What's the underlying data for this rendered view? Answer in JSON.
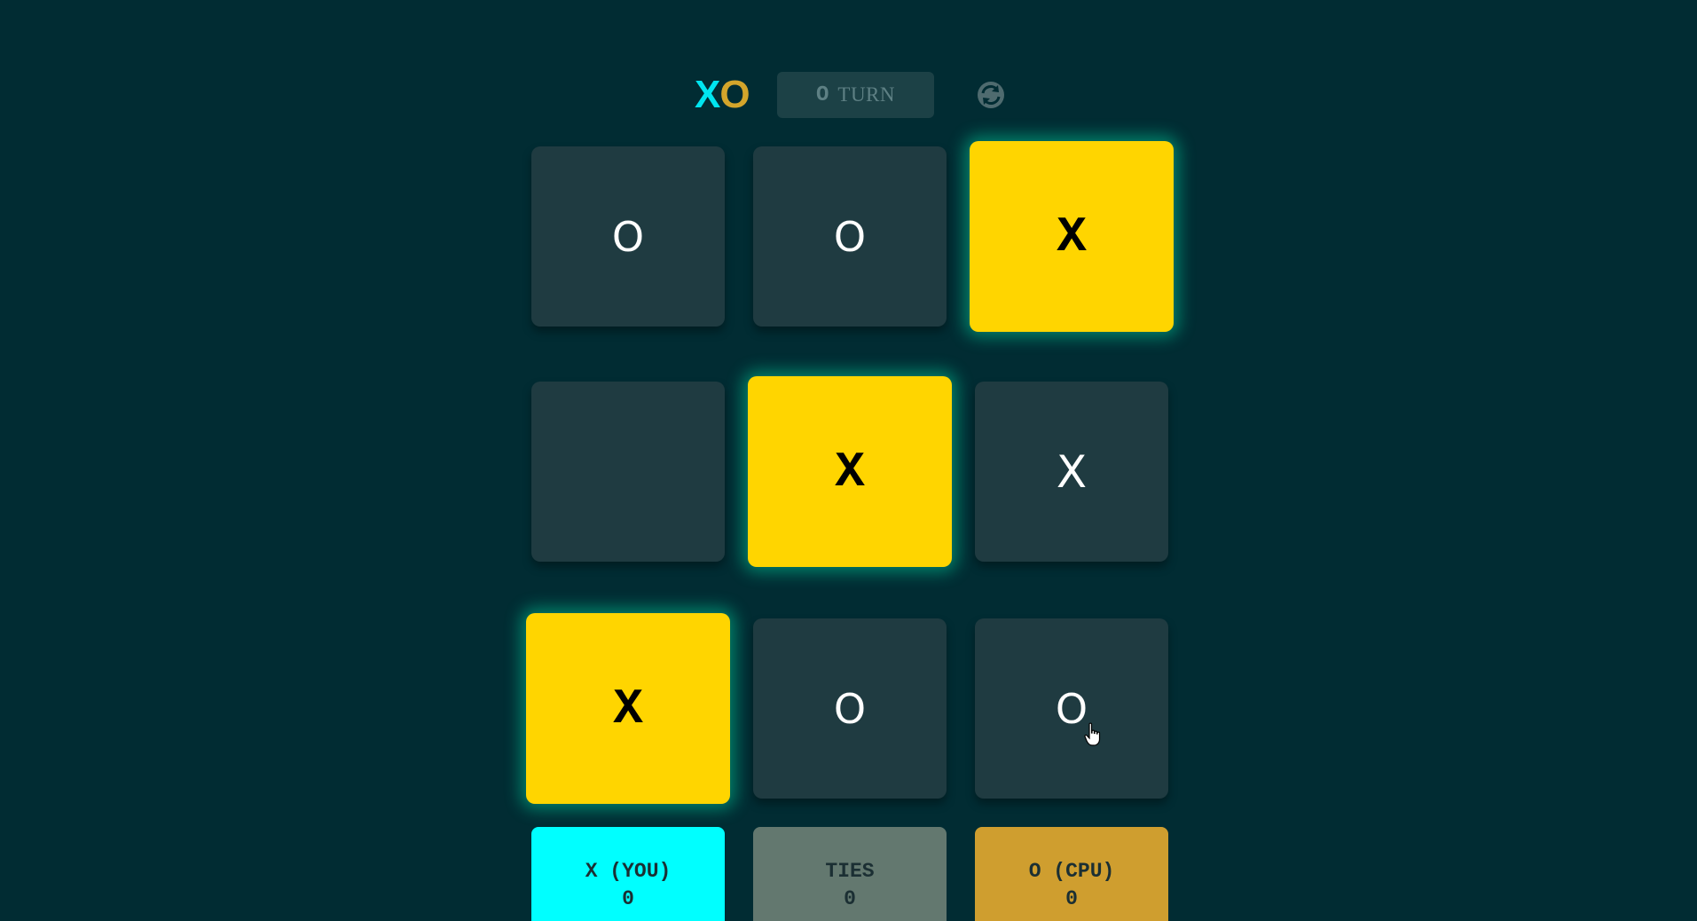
{
  "logo": {
    "x": "X",
    "o": "O"
  },
  "turn": {
    "mark": "O",
    "label": "TURN"
  },
  "board": {
    "cells": [
      "O",
      "O",
      "X",
      "",
      "X",
      "X",
      "X",
      "O",
      "O"
    ],
    "winning_cells": [
      2,
      4,
      6
    ]
  },
  "scores": {
    "you": {
      "label": "X (YOU)",
      "value": "0"
    },
    "ties": {
      "label": "TIES",
      "value": "0"
    },
    "cpu": {
      "label": "O (CPU)",
      "value": "0"
    }
  },
  "colors": {
    "background": "#012c33",
    "cell": "#1f3b41",
    "win_cell": "#ffd500",
    "x_accent": "#00ffff",
    "o_accent": "#cf9e2f",
    "ties": "#63786f"
  },
  "icons": {
    "restart": "restart-icon"
  }
}
